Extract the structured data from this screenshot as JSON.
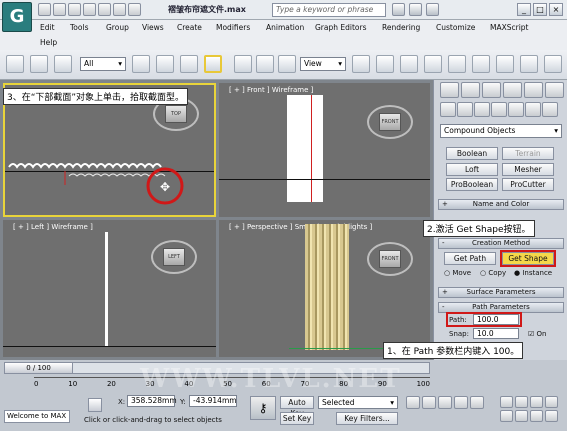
{
  "window": {
    "title": "褶皱布帘遮文件.max",
    "help_search_placeholder": "Type a keyword or phrase"
  },
  "app_icon": "3ds-max-logo",
  "menu": {
    "items": [
      "Edit",
      "Tools",
      "Group",
      "Views",
      "Create",
      "Modifiers",
      "Animation",
      "Graph Editors",
      "Rendering",
      "Customize",
      "MAXScript",
      "Help"
    ]
  },
  "toolbar": {
    "selection_filter": "All",
    "ref_coord": "View"
  },
  "viewports": {
    "top": {
      "label": "",
      "cube": "TOP"
    },
    "front": {
      "label": "[ + ] Front ] Wireframe ]",
      "cube": "FRONT"
    },
    "left": {
      "label": "[ + ] Left ] Wireframe ]",
      "cube": "LEFT"
    },
    "perspective": {
      "label": "[ + ] Perspective ] Smooth + Highlights ]",
      "cube": "FRONT"
    }
  },
  "command_panel": {
    "category": "Compound Objects",
    "object_types": [
      "Boolean",
      "Terrain",
      "Loft",
      "Mesher",
      "ProBoolean",
      "ProCutter"
    ],
    "rollouts": {
      "name_color": "Name and Color",
      "creation_method": "Creation Method",
      "surface": "Surface Parameters",
      "path": "Path Parameters"
    },
    "get_path": "Get Path",
    "get_shape": "Get Shape",
    "move": "Move",
    "copy": "Copy",
    "instance": "Instance",
    "path_label": "Path:",
    "path_value": "100.0",
    "snap_label": "Snap:",
    "snap_value": "10.0",
    "on_label": "On"
  },
  "timeline": {
    "frame": "0 / 100",
    "ticks": [
      "0",
      "10",
      "20",
      "30",
      "40",
      "50",
      "60",
      "70",
      "80",
      "90",
      "100"
    ]
  },
  "status": {
    "welcome": "Welcome to MAX",
    "x_label": "X:",
    "x_value": "358.528mm",
    "y_label": "Y:",
    "y_value": "-43.914mm",
    "prompt": "Click or click-and-drag to select objects",
    "auto_key": "Auto Key",
    "set_key": "Set Key",
    "key_mode": "Selected",
    "key_filters": "Key Filters..."
  },
  "callouts": {
    "step3": "3、在“下部截面”对象上单击，拾取截面型。",
    "step2": "2.激活 Get Shape按钮。",
    "step1": "1、在 Path 参数栏内键入 100。"
  },
  "watermark": "WWW.TLVL.NET",
  "accent_color": "#e8d43a",
  "highlight_color": "#d01818"
}
